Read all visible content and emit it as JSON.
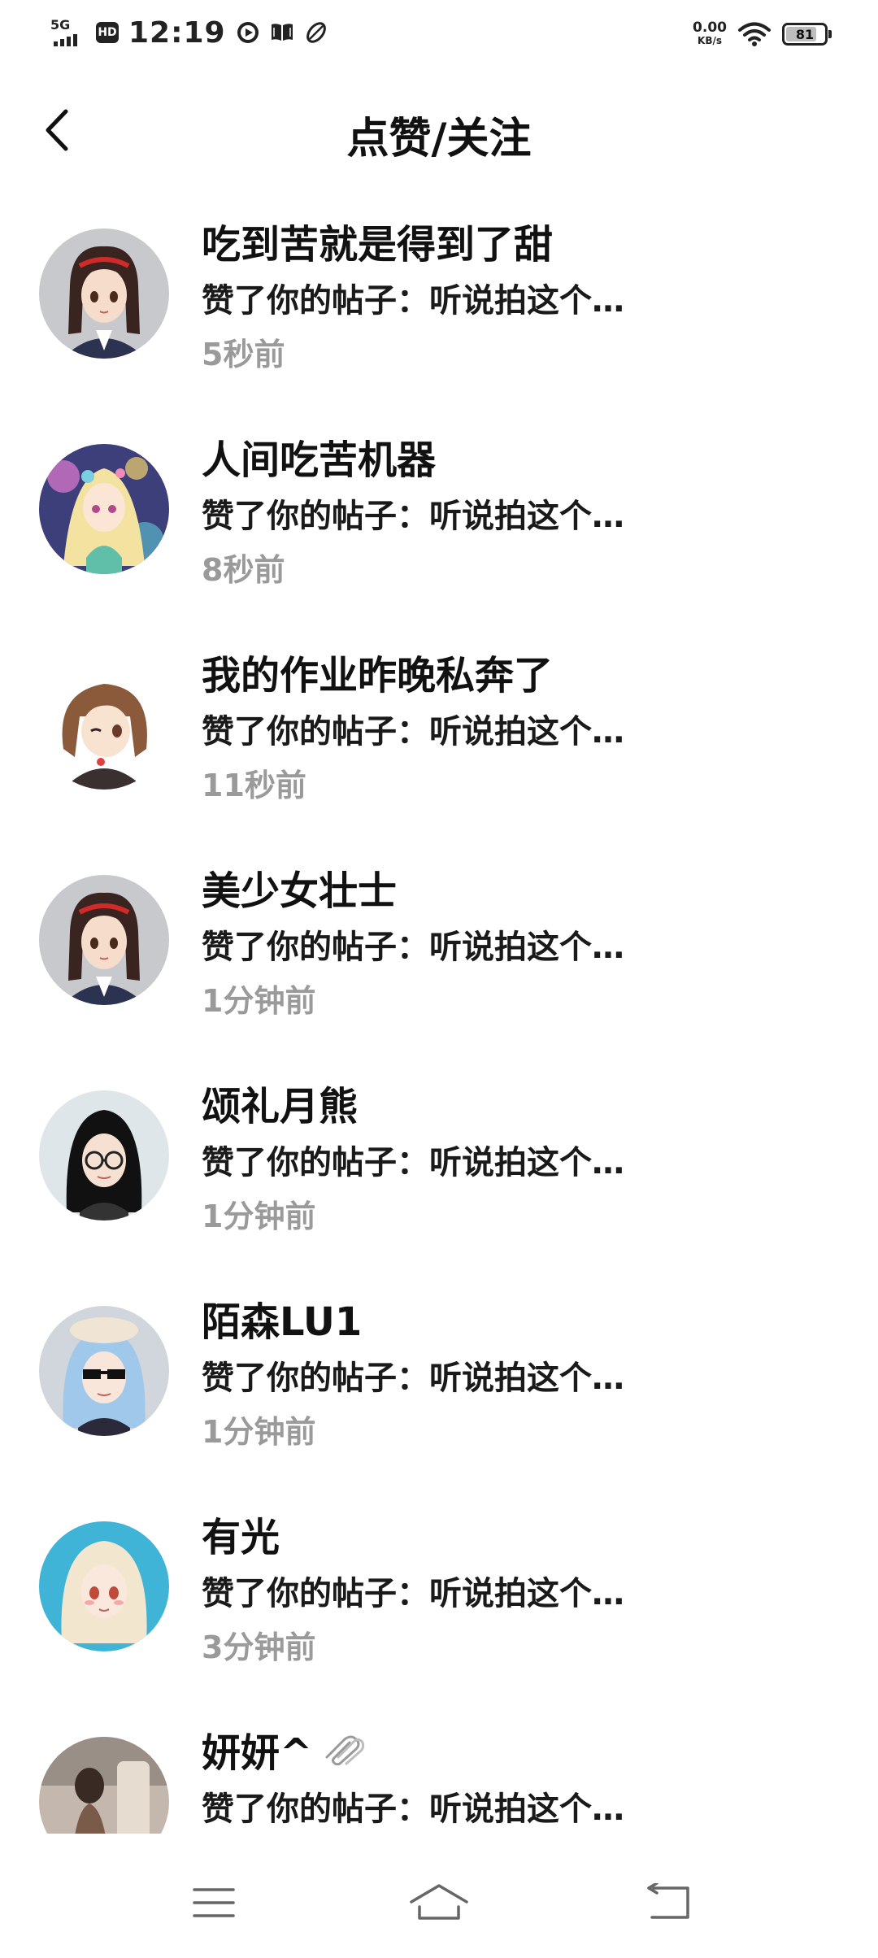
{
  "status_bar": {
    "network": "5G",
    "hd": "HD",
    "time": "12:19",
    "speed_value": "0.00",
    "speed_unit": "KB/s",
    "battery": "81",
    "battery_level": 0.81,
    "icons": [
      "play-circle-icon",
      "book-icon",
      "leaf-icon",
      "wifi-icon",
      "battery-icon"
    ]
  },
  "header": {
    "title": "点赞/关注",
    "back_icon": "chevron-left-icon"
  },
  "notifications": [
    {
      "name": "吃到苦就是得到了甜",
      "action": "赞了你的帖子：听说拍这个…",
      "time": "5秒前"
    },
    {
      "name": "人间吃苦机器",
      "action": "赞了你的帖子：听说拍这个…",
      "time": "8秒前"
    },
    {
      "name": "我的作业昨晚私奔了",
      "action": "赞了你的帖子：听说拍这个…",
      "time": "11秒前"
    },
    {
      "name": "美少女壮士",
      "action": "赞了你的帖子：听说拍这个…",
      "time": "1分钟前"
    },
    {
      "name": "颂礼月熊",
      "action": "赞了你的帖子：听说拍这个…",
      "time": "1分钟前"
    },
    {
      "name": "陌森LU1",
      "action": "赞了你的帖子：听说拍这个…",
      "time": "1分钟前"
    },
    {
      "name": "有光",
      "action": "赞了你的帖子：听说拍这个…",
      "time": "3分钟前"
    },
    {
      "name": "妍妍^",
      "action": "赞了你的帖子：听说拍这个…",
      "time": ""
    }
  ],
  "nav_bar": {
    "icons": [
      "menu-icon",
      "home-icon",
      "back-icon"
    ]
  },
  "colors": {
    "text_primary": "#111111",
    "text_secondary": "#9a9a9a",
    "background": "#ffffff"
  }
}
